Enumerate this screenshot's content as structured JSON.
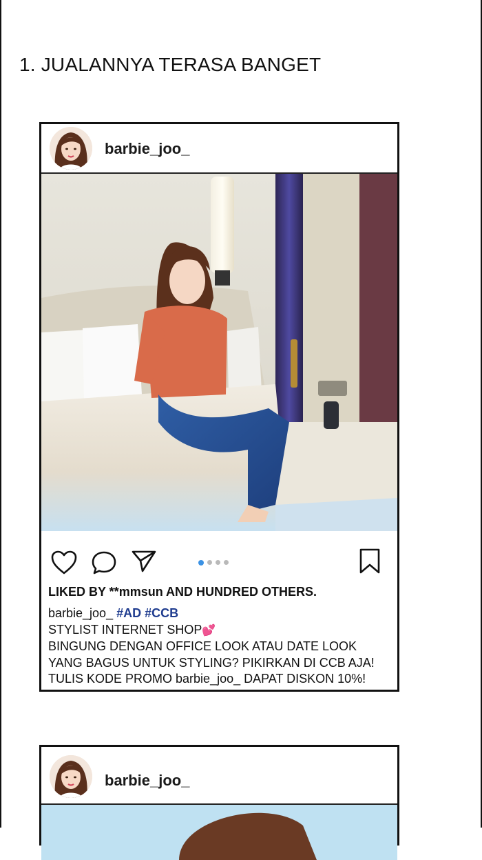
{
  "heading": "1. JUALANNYA TERASA BANGET",
  "posts": [
    {
      "username": "barbie_joo_",
      "likes": "LIKED BY **mmsun AND HUNDRED OTHERS.",
      "caption": {
        "user": "barbie_joo_",
        "tags": [
          "#AD",
          "#CCB"
        ],
        "line1": "STYLIST INTERNET SHOP",
        "emoji": "💕",
        "line2": "BINGUNG DENGAN OFFICE LOOK ATAU DATE LOOK",
        "line3": "YANG BAGUS UNTUK STYLING? PIKIRKAN DI CCB AJA!",
        "line4": "TULIS KODE PROMO barbie_joo_ DAPAT DISKON 10%!"
      },
      "carousel": {
        "count": 4,
        "active": 1
      },
      "icons": [
        "heart-icon",
        "comment-icon",
        "send-icon",
        "bookmark-icon"
      ]
    },
    {
      "username": "barbie_joo_"
    }
  ],
  "colors": {
    "tag": "#1f3c8f",
    "active_dot": "#3b92e4",
    "inactive_dot": "#b9b9b9"
  }
}
